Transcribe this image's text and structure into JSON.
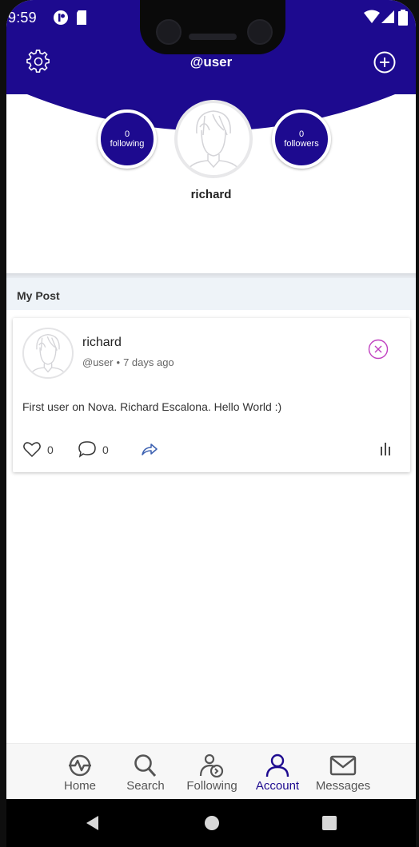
{
  "status_bar": {
    "time": "9:59"
  },
  "header": {
    "title": "@user"
  },
  "profile": {
    "following_count": "0",
    "following_label": "following",
    "followers_count": "0",
    "followers_label": "followers",
    "username": "richard"
  },
  "section": {
    "title": "My Post"
  },
  "post": {
    "author": "richard",
    "handle": "@user",
    "separator": "•",
    "time_ago": "7 days ago",
    "text": "First user on Nova. Richard Escalona. Hello World :)",
    "likes": "0",
    "comments": "0"
  },
  "nav": {
    "items": [
      {
        "label": "Home",
        "icon": "home-activity-icon"
      },
      {
        "label": "Search",
        "icon": "search-icon"
      },
      {
        "label": "Following",
        "icon": "following-icon"
      },
      {
        "label": "Account",
        "icon": "account-icon",
        "active": true
      },
      {
        "label": "Messages",
        "icon": "mail-icon"
      }
    ]
  },
  "colors": {
    "brand": "#1d0a8f",
    "close_accent": "#c040c0",
    "share_accent": "#3a5fb0"
  }
}
